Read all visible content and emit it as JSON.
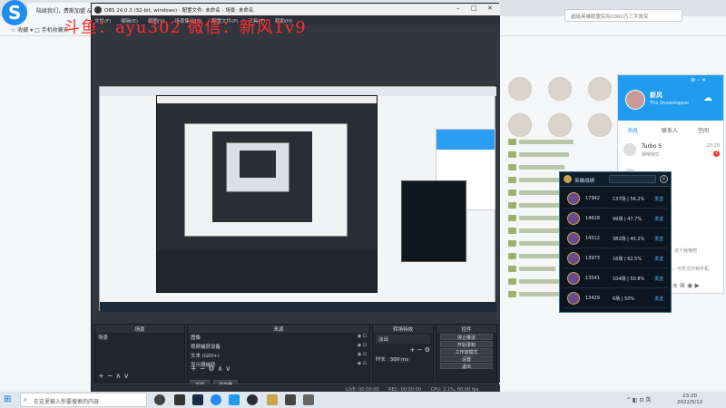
{
  "browser": {
    "tab_title": "陆续我们，费斯加盟 &...",
    "search_placeholder": "超级英雄联盟实际1000万三字真实",
    "bookmarks": "☆ 收藏 ▾  □ 手机收藏夹"
  },
  "watermark": "斗鱼：ayu302  微信：新风1v9",
  "obs": {
    "title": "OBS 24.0.3 (32-bit, windows) - 配置文件: 未命名 - 场景: 未命名",
    "menu": [
      "文件(F)",
      "编辑(E)",
      "视图(V)",
      "场景集合(S)",
      "配置文件(P)",
      "工具(T)",
      "帮助(H)"
    ],
    "docks": {
      "scenes": {
        "title": "场景",
        "items": [
          "场景"
        ]
      },
      "sources": {
        "title": "来源",
        "items": [
          "图像",
          "视频捕获设备",
          "文本 (GDI+)",
          "显示器捕获"
        ]
      },
      "mixer": {
        "title": "转场特效",
        "transition": "淡出",
        "duration_label": "时长",
        "duration": "300 ms"
      },
      "controls": {
        "title": "控件",
        "buttons": [
          "停止推流",
          "开始录制",
          "工作室模式",
          "设置",
          "退出"
        ]
      }
    },
    "source_tabs": [
      "来源",
      "混音器"
    ],
    "status": {
      "live": "LIVE: 00:00:00",
      "rec": "REC: 00:00:00",
      "cpu": "CPU: 2.1%, 60.00 fps"
    }
  },
  "qq": {
    "name": "新风",
    "signature": "The Showstopper",
    "tabs": [
      "消息",
      "联系人",
      "空间"
    ],
    "messages": [
      {
        "name": "Turbo S",
        "msg": "那呐我忙",
        "time": "23:20",
        "badge": "2"
      },
      {
        "name": "",
        "msg": "",
        "time": "",
        "badge": ""
      },
      {
        "name": "",
        "msg": "",
        "time": "",
        "badge": ""
      },
      {
        "name": "",
        "msg": "",
        "time": "",
        "badge": ""
      },
      {
        "name": "",
        "msg": "这个我哦吧",
        "time": "",
        "badge": ""
      },
      {
        "name": "",
        "msg": "，可传文件到手机",
        "time": "",
        "badge": ""
      }
    ]
  },
  "lol": {
    "title": "英雄战绩",
    "rows": [
      {
        "score": "17942",
        "record": "137场 | 56.2%",
        "action": "发送"
      },
      {
        "score": "14618",
        "record": "99场 | 47.7%",
        "action": "发送"
      },
      {
        "score": "14512",
        "record": "382场 | 45.2%",
        "action": "发送"
      },
      {
        "score": "13973",
        "record": "16场 | 62.5%",
        "action": "发送"
      },
      {
        "score": "13541",
        "record": "104场 | 50.8%",
        "action": "发送"
      },
      {
        "score": "13429",
        "record": "6场 | 50%",
        "action": "发送"
      }
    ]
  },
  "taskbar": {
    "search": "在这里输入你要搜索的内容",
    "time": "23:20",
    "date": "2022/5/12",
    "tray": "^ ◧ ⊡ 英"
  },
  "colors": {
    "obs_bg": "#2b2e38",
    "qq_blue": "#1f9bf0",
    "lol_bg": "#0c1520",
    "accent": "#4fb6ff"
  },
  "icons": [
    "logo",
    "start-icon",
    "search-icon",
    "close-icon",
    "gear-icon",
    "eye-icon",
    "lock-icon"
  ]
}
